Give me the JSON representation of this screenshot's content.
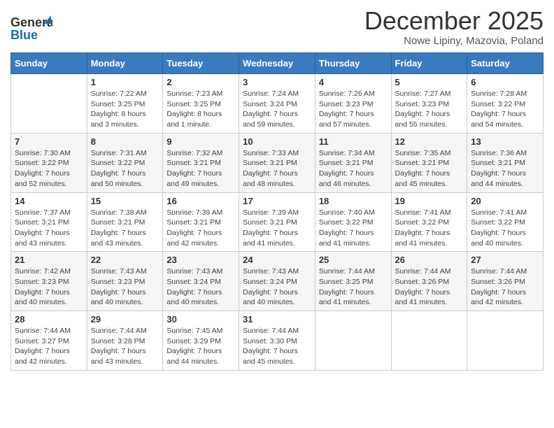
{
  "logo": {
    "line1": "General",
    "line2": "Blue"
  },
  "title": "December 2025",
  "location": "Nowe Lipiny, Mazovia, Poland",
  "days_header": [
    "Sunday",
    "Monday",
    "Tuesday",
    "Wednesday",
    "Thursday",
    "Friday",
    "Saturday"
  ],
  "weeks": [
    [
      {
        "day": "",
        "info": ""
      },
      {
        "day": "1",
        "info": "Sunrise: 7:22 AM\nSunset: 3:25 PM\nDaylight: 8 hours\nand 3 minutes."
      },
      {
        "day": "2",
        "info": "Sunrise: 7:23 AM\nSunset: 3:25 PM\nDaylight: 8 hours\nand 1 minute."
      },
      {
        "day": "3",
        "info": "Sunrise: 7:24 AM\nSunset: 3:24 PM\nDaylight: 7 hours\nand 59 minutes."
      },
      {
        "day": "4",
        "info": "Sunrise: 7:26 AM\nSunset: 3:23 PM\nDaylight: 7 hours\nand 57 minutes."
      },
      {
        "day": "5",
        "info": "Sunrise: 7:27 AM\nSunset: 3:23 PM\nDaylight: 7 hours\nand 55 minutes."
      },
      {
        "day": "6",
        "info": "Sunrise: 7:28 AM\nSunset: 3:22 PM\nDaylight: 7 hours\nand 54 minutes."
      }
    ],
    [
      {
        "day": "7",
        "info": "Sunrise: 7:30 AM\nSunset: 3:22 PM\nDaylight: 7 hours\nand 52 minutes."
      },
      {
        "day": "8",
        "info": "Sunrise: 7:31 AM\nSunset: 3:22 PM\nDaylight: 7 hours\nand 50 minutes."
      },
      {
        "day": "9",
        "info": "Sunrise: 7:32 AM\nSunset: 3:21 PM\nDaylight: 7 hours\nand 49 minutes."
      },
      {
        "day": "10",
        "info": "Sunrise: 7:33 AM\nSunset: 3:21 PM\nDaylight: 7 hours\nand 48 minutes."
      },
      {
        "day": "11",
        "info": "Sunrise: 7:34 AM\nSunset: 3:21 PM\nDaylight: 7 hours\nand 46 minutes."
      },
      {
        "day": "12",
        "info": "Sunrise: 7:35 AM\nSunset: 3:21 PM\nDaylight: 7 hours\nand 45 minutes."
      },
      {
        "day": "13",
        "info": "Sunrise: 7:36 AM\nSunset: 3:21 PM\nDaylight: 7 hours\nand 44 minutes."
      }
    ],
    [
      {
        "day": "14",
        "info": "Sunrise: 7:37 AM\nSunset: 3:21 PM\nDaylight: 7 hours\nand 43 minutes."
      },
      {
        "day": "15",
        "info": "Sunrise: 7:38 AM\nSunset: 3:21 PM\nDaylight: 7 hours\nand 43 minutes."
      },
      {
        "day": "16",
        "info": "Sunrise: 7:39 AM\nSunset: 3:21 PM\nDaylight: 7 hours\nand 42 minutes."
      },
      {
        "day": "17",
        "info": "Sunrise: 7:39 AM\nSunset: 3:21 PM\nDaylight: 7 hours\nand 41 minutes."
      },
      {
        "day": "18",
        "info": "Sunrise: 7:40 AM\nSunset: 3:22 PM\nDaylight: 7 hours\nand 41 minutes."
      },
      {
        "day": "19",
        "info": "Sunrise: 7:41 AM\nSunset: 3:22 PM\nDaylight: 7 hours\nand 41 minutes."
      },
      {
        "day": "20",
        "info": "Sunrise: 7:41 AM\nSunset: 3:22 PM\nDaylight: 7 hours\nand 40 minutes."
      }
    ],
    [
      {
        "day": "21",
        "info": "Sunrise: 7:42 AM\nSunset: 3:23 PM\nDaylight: 7 hours\nand 40 minutes."
      },
      {
        "day": "22",
        "info": "Sunrise: 7:43 AM\nSunset: 3:23 PM\nDaylight: 7 hours\nand 40 minutes."
      },
      {
        "day": "23",
        "info": "Sunrise: 7:43 AM\nSunset: 3:24 PM\nDaylight: 7 hours\nand 40 minutes."
      },
      {
        "day": "24",
        "info": "Sunrise: 7:43 AM\nSunset: 3:24 PM\nDaylight: 7 hours\nand 40 minutes."
      },
      {
        "day": "25",
        "info": "Sunrise: 7:44 AM\nSunset: 3:25 PM\nDaylight: 7 hours\nand 41 minutes."
      },
      {
        "day": "26",
        "info": "Sunrise: 7:44 AM\nSunset: 3:26 PM\nDaylight: 7 hours\nand 41 minutes."
      },
      {
        "day": "27",
        "info": "Sunrise: 7:44 AM\nSunset: 3:26 PM\nDaylight: 7 hours\nand 42 minutes."
      }
    ],
    [
      {
        "day": "28",
        "info": "Sunrise: 7:44 AM\nSunset: 3:27 PM\nDaylight: 7 hours\nand 42 minutes."
      },
      {
        "day": "29",
        "info": "Sunrise: 7:44 AM\nSunset: 3:28 PM\nDaylight: 7 hours\nand 43 minutes."
      },
      {
        "day": "30",
        "info": "Sunrise: 7:45 AM\nSunset: 3:29 PM\nDaylight: 7 hours\nand 44 minutes."
      },
      {
        "day": "31",
        "info": "Sunrise: 7:44 AM\nSunset: 3:30 PM\nDaylight: 7 hours\nand 45 minutes."
      },
      {
        "day": "",
        "info": ""
      },
      {
        "day": "",
        "info": ""
      },
      {
        "day": "",
        "info": ""
      }
    ]
  ]
}
